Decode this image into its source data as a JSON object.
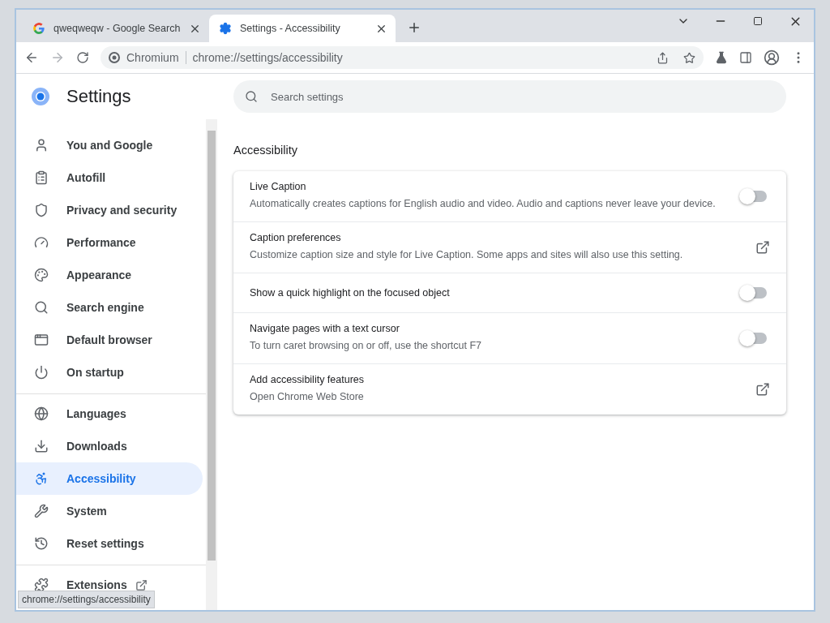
{
  "tabs": [
    {
      "title": "qweqweqw - Google Search",
      "kind": "google",
      "selected": false
    },
    {
      "title": "Settings - Accessibility",
      "kind": "settings",
      "selected": true
    }
  ],
  "toolbar": {
    "back_disabled": false,
    "forward_disabled": true,
    "site_label": "Chromium",
    "url": "chrome://settings/accessibility"
  },
  "app_title": "Settings",
  "search": {
    "placeholder": "Search settings"
  },
  "sidebar": {
    "groups": [
      {
        "items": [
          {
            "label": "You and Google",
            "selected": false
          },
          {
            "label": "Autofill",
            "selected": false
          },
          {
            "label": "Privacy and security",
            "selected": false
          },
          {
            "label": "Performance",
            "selected": false
          },
          {
            "label": "Appearance",
            "selected": false
          },
          {
            "label": "Search engine",
            "selected": false
          },
          {
            "label": "Default browser",
            "selected": false
          },
          {
            "label": "On startup",
            "selected": false
          }
        ]
      },
      {
        "items": [
          {
            "label": "Languages",
            "selected": false
          },
          {
            "label": "Downloads",
            "selected": false
          },
          {
            "label": "Accessibility",
            "selected": true
          },
          {
            "label": "System",
            "selected": false
          },
          {
            "label": "Reset settings",
            "selected": false
          }
        ]
      },
      {
        "items": [
          {
            "label": "Extensions",
            "selected": false,
            "external": true
          }
        ]
      }
    ]
  },
  "section_title": "Accessibility",
  "settings": [
    {
      "kind": "toggle",
      "title": "Live Caption",
      "description": "Automatically creates captions for English audio and video. Audio and captions never leave your device.",
      "on": false
    },
    {
      "kind": "link",
      "title": "Caption preferences",
      "description": "Customize caption size and style for Live Caption. Some apps and sites will also use this setting."
    },
    {
      "kind": "toggle",
      "title": "Show a quick highlight on the focused object",
      "on": false
    },
    {
      "kind": "toggle",
      "title": "Navigate pages with a text cursor",
      "description": "To turn caret browsing on or off, use the shortcut F7",
      "on": false
    },
    {
      "kind": "link",
      "title": "Add accessibility features",
      "description": "Open Chrome Web Store"
    }
  ],
  "status_bubble": "chrome://settings/accessibility"
}
